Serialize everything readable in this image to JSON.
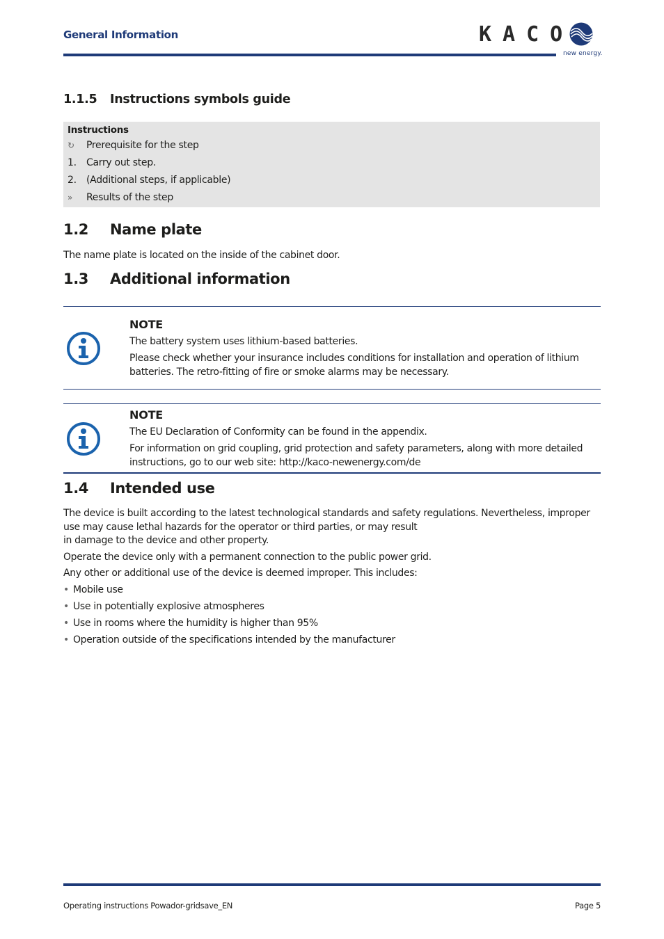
{
  "header": {
    "section_title": "General Information",
    "logo_text": "KACO",
    "logo_tagline": "new energy."
  },
  "section_1_1_5": {
    "number": "1.1.5",
    "title": "Instructions symbols guide",
    "box": {
      "title": "Instructions",
      "rows": [
        {
          "symbol": "↻",
          "symbol_name": "prerequisite-icon",
          "text": "Prerequisite for the step"
        },
        {
          "symbol": "1.",
          "symbol_name": "step-number",
          "text": "Carry out step."
        },
        {
          "symbol": "2.",
          "symbol_name": "step-number",
          "text": "(Additional steps, if applicable)"
        },
        {
          "symbol": "»",
          "symbol_name": "result-icon",
          "text": "Results of the step"
        }
      ]
    }
  },
  "section_1_2": {
    "number": "1.2",
    "title": "Name plate",
    "text": "The name plate is located on the inside of the cabinet door."
  },
  "section_1_3": {
    "number": "1.3",
    "title": "Additional information",
    "notes": [
      {
        "icon": "info-icon",
        "title": "NOTE",
        "lines": [
          "The battery system uses lithium-based batteries.",
          "Please check whether your insurance includes conditions for installation and operation of lithium batteries. The retro-fitting of fire or smoke alarms may be necessary."
        ]
      },
      {
        "icon": "info-icon",
        "title": "NOTE",
        "lines": [
          "The EU Declaration of Conformity can be found in the appendix.",
          "For information on grid coupling, grid protection and safety parameters, along with more detailed instructions, go to our web site: http://kaco-newenergy.com/de"
        ]
      }
    ]
  },
  "section_1_4": {
    "number": "1.4",
    "title": "Intended use",
    "paragraphs": [
      "The device is built according to the latest technological standards and safety regulations. Nevertheless, improper use may cause lethal hazards for the operator or third parties, or may result",
      "in damage to the device and other property.",
      "Operate the device only with a permanent connection to the public power grid.",
      "Any other or additional use of the device is deemed improper.  This includes:"
    ],
    "bullet_symbol": "•",
    "bullets": [
      "Mobile use",
      "Use in potentially explosive atmospheres",
      "Use in rooms where the humidity is higher than 95%",
      "Operation outside of the specifications intended by the manufacturer"
    ]
  },
  "footer": {
    "document": "Operating instructions Powador-gridsave_EN",
    "page": "Page 5"
  },
  "colors": {
    "brand_blue": "#1e3a78",
    "info_icon_blue": "#1b63ad",
    "box_gray": "#e4e4e4",
    "text": "#1d1d1b"
  }
}
